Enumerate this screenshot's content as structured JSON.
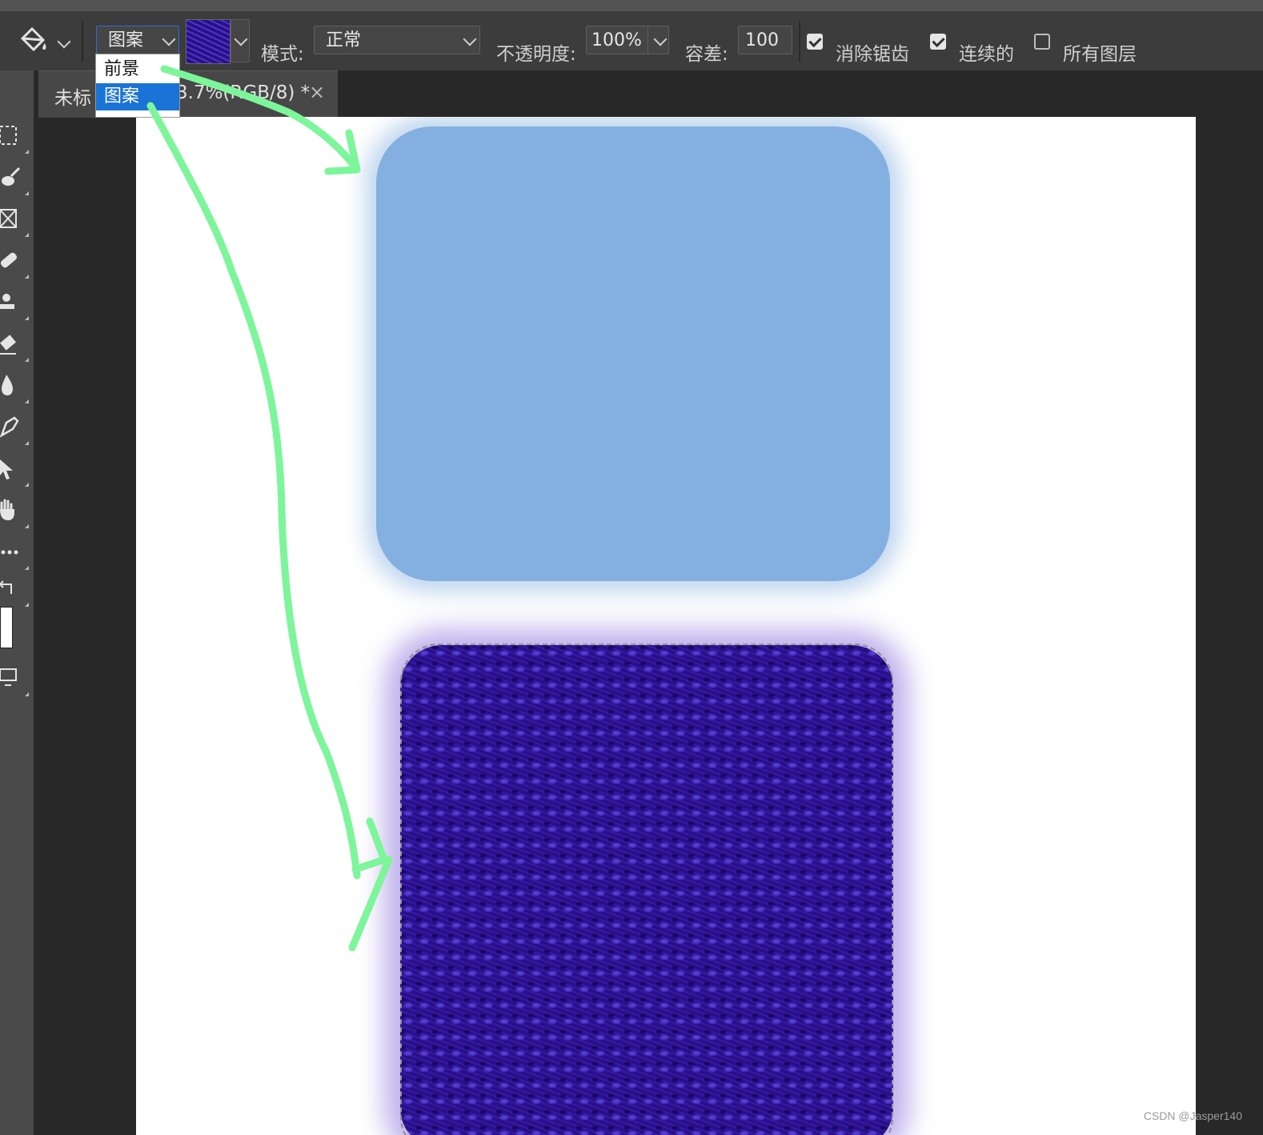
{
  "options_bar": {
    "fill_source_value": "图案",
    "mode_label": "模式:",
    "mode_value": "正常",
    "opacity_label": "不透明度:",
    "opacity_value": "100%",
    "tolerance_label": "容差:",
    "tolerance_value": "100",
    "antialias_label": "消除锯齿",
    "antialias_checked": true,
    "contiguous_label": "连续的",
    "contiguous_checked": true,
    "all_layers_label": "所有图层",
    "all_layers_checked": false
  },
  "fill_source_dropdown": {
    "options": [
      "前景",
      "图案"
    ],
    "selected": "图案"
  },
  "document_tab": {
    "title_left": "未标",
    "title_right": "3.7%(RGB/8) *",
    "close_glyph": "×"
  },
  "colors": {
    "blue_fill": "#83b0e0",
    "pattern_fill": "#2a0f8a",
    "annotation_arrow": "#7df59a",
    "selected_item": "#1a73d6"
  },
  "watermark": "CSDN @Jasper140"
}
